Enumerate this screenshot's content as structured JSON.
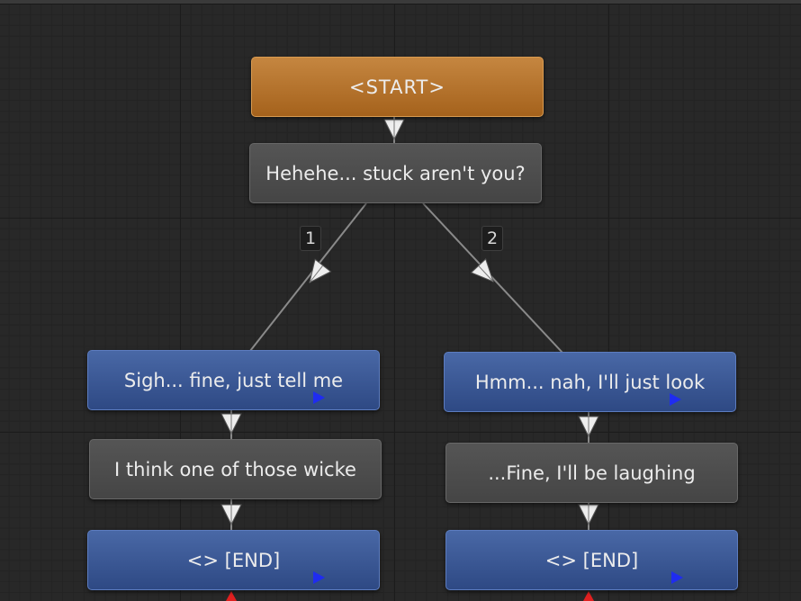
{
  "nodes": {
    "start": "<START>",
    "root": "Hehehe... stuck aren't you?",
    "choice1": "Sigh... fine, just tell me",
    "choice2": "Hmm... nah, I'll just look",
    "reply1": "I think one of those wicke",
    "reply2": "...Fine, I'll be laughing",
    "end1": "<> [END]",
    "end2": "<> [END]"
  },
  "branch_labels": [
    "1",
    "2"
  ],
  "icons": {
    "connection_arrow": "down-arrow-icon",
    "audio": "play-icon",
    "end_marker": "red-triangle-icon"
  },
  "colors": {
    "canvas": "#282828",
    "start_node": "#b87630",
    "npc_node": "#4d4d4d",
    "player_node": "#3a5a98",
    "connector": "#8a8a8a",
    "arrow": "#eeeeee",
    "play_icon": "#1f2cf0",
    "end_marker": "#e02020"
  }
}
